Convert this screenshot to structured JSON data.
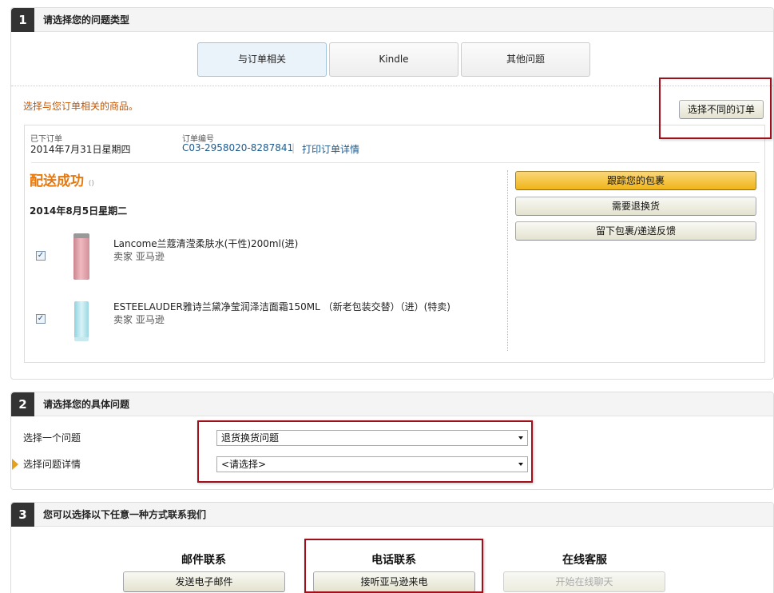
{
  "section1": {
    "number": "1",
    "title": "请选择您的问题类型",
    "tabs": [
      {
        "label": "与订单相关",
        "active": true
      },
      {
        "label": "Kindle",
        "active": false
      },
      {
        "label": "其他问题",
        "active": false
      }
    ],
    "pick_label": "选择与您订单相关的商品。",
    "select_other_order_button": "选择不同的订单",
    "order": {
      "placed_label": "已下订单",
      "placed_date": "2014年7月31日星期四",
      "number_label": "订单编号",
      "number": "C03-2958020-8287841",
      "separator": "|",
      "print_link": "打印订单详情",
      "status": "配送成功",
      "status_suffix": "()",
      "delivery_date": "2014年8月5日星期二",
      "items": [
        {
          "name": "Lancome兰蔻清滢柔肤水(干性)200ml(进)",
          "seller": "卖家 亚马逊",
          "checked": true
        },
        {
          "name": "ESTEELAUDER雅诗兰黛净莹润泽洁面霜150ML （新老包装交替）（进）(特卖)",
          "seller": "卖家 亚马逊",
          "checked": true
        }
      ],
      "actions": [
        "跟踪您的包裹",
        "需要退换货",
        "留下包裹/递送反馈"
      ]
    }
  },
  "section2": {
    "number": "2",
    "title": "请选择您的具体问题",
    "issue_label": "选择一个问题",
    "issue_value": "退货换货问题",
    "detail_label": "选择问题详情",
    "detail_value": "<请选择>"
  },
  "section3": {
    "number": "3",
    "title": "您可以选择以下任意一种方式联系我们",
    "methods": [
      {
        "title": "邮件联系",
        "button": "发送电子邮件",
        "enabled": true
      },
      {
        "title": "电话联系",
        "button": "接听亚马逊来电",
        "enabled": true
      },
      {
        "title": "在线客服",
        "button": "开始在线聊天",
        "enabled": false
      }
    ]
  },
  "colors": {
    "highlight": "#a0101a",
    "accent_orange": "#e47911",
    "link": "#1d5b8f",
    "header_dark": "#333333"
  }
}
